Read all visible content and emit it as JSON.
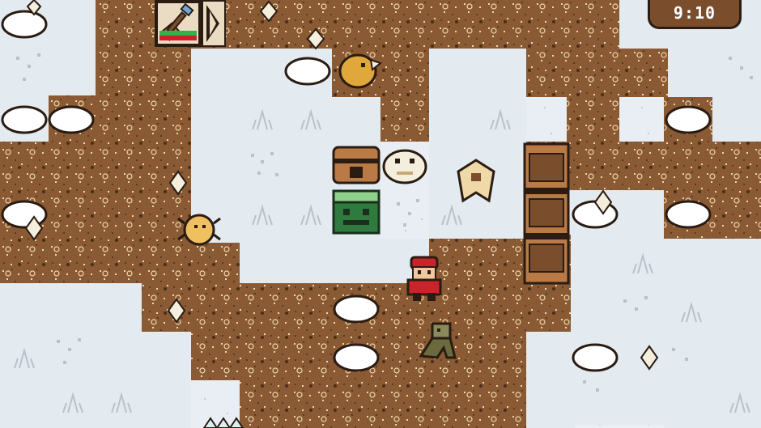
{
  "hud": {
    "clock_text": "9:10",
    "tool_name": "shovel-icon",
    "health_fraction": 1.0,
    "stamina_fraction": 1.0
  },
  "colors": {
    "snow": "#e8eef3",
    "dirt": "#8a5a34",
    "dirt_dark": "#2a1c12",
    "rock": "#ffffff",
    "chest_green": "#2f7a3e",
    "player_red": "#c9242a",
    "clock_bg": "#7a4e2d"
  },
  "entities": [
    {
      "name": "player-character"
    },
    {
      "name": "green-chest"
    },
    {
      "name": "wooden-chest"
    },
    {
      "name": "yellow-bird-enemy"
    },
    {
      "name": "yellow-spider-enemy"
    },
    {
      "name": "sheep-creature"
    },
    {
      "name": "bat-creature"
    },
    {
      "name": "goblin-creature"
    },
    {
      "name": "wooden-bridge-pillar"
    }
  ]
}
